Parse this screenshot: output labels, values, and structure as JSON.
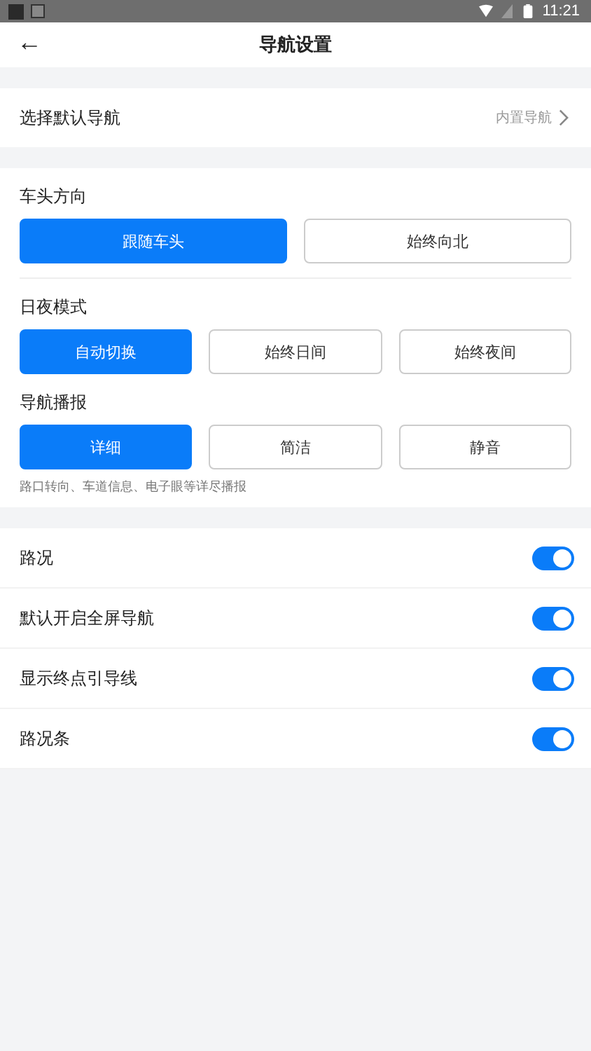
{
  "status_bar": {
    "time": "11:21"
  },
  "header": {
    "back": "←",
    "title": "导航设置"
  },
  "default_nav": {
    "label": "选择默认导航",
    "value": "内置导航"
  },
  "option_groups": [
    {
      "title": "车头方向",
      "options": [
        {
          "label": "跟随车头",
          "selected": true
        },
        {
          "label": "始终向北",
          "selected": false
        }
      ]
    },
    {
      "title": "日夜模式",
      "options": [
        {
          "label": "自动切换",
          "selected": true
        },
        {
          "label": "始终日间",
          "selected": false
        },
        {
          "label": "始终夜间",
          "selected": false
        }
      ]
    },
    {
      "title": "导航播报",
      "options": [
        {
          "label": "详细",
          "selected": true
        },
        {
          "label": "简洁",
          "selected": false
        },
        {
          "label": "静音",
          "selected": false
        }
      ],
      "hint": "路口转向、车道信息、电子眼等详尽播报"
    }
  ],
  "toggles": [
    {
      "label": "路况",
      "on": true
    },
    {
      "label": "默认开启全屏导航",
      "on": true
    },
    {
      "label": "显示终点引导线",
      "on": true
    },
    {
      "label": "路况条",
      "on": true
    }
  ]
}
